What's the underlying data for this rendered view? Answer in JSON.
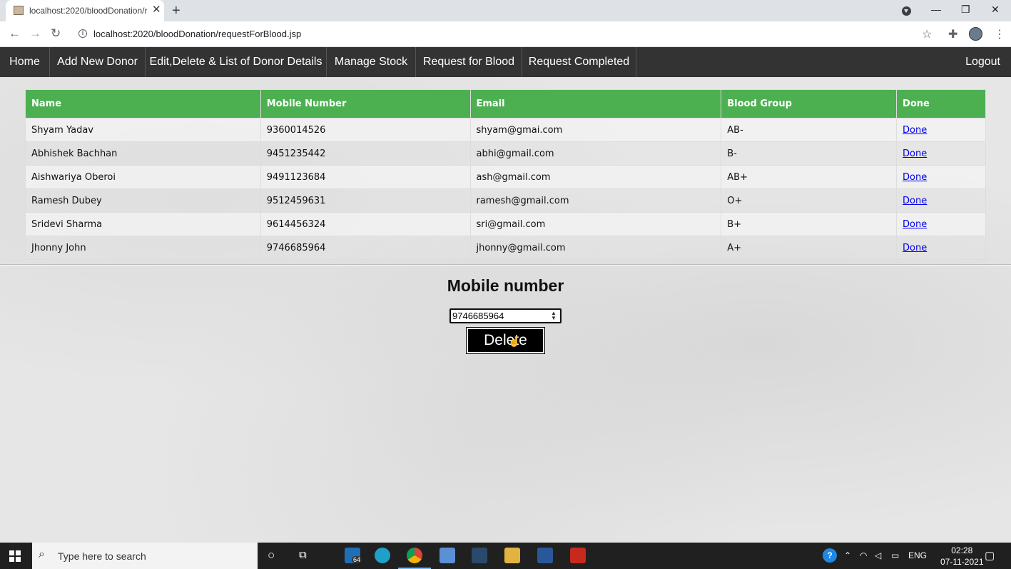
{
  "browser": {
    "tab_title": "localhost:2020/bloodDonation/requestForBlood.jsp",
    "new_tab": "+",
    "url": "localhost:2020/bloodDonation/requestForBlood.jsp",
    "icons": [
      "back-icon",
      "forward-icon",
      "reload-icon",
      "info-icon",
      "star-icon",
      "extensions-icon",
      "profile-avatar",
      "menu-icon"
    ]
  },
  "navbar": {
    "items": [
      {
        "label": "Home"
      },
      {
        "label": "Add New Donor"
      },
      {
        "label": "Edit,Delete & List of Donor Details"
      },
      {
        "label": "Manage Stock"
      },
      {
        "label": "Request for Blood"
      },
      {
        "label": "Request Completed"
      }
    ],
    "logout": "Logout"
  },
  "table": {
    "headers": [
      "Name",
      "Mobile Number",
      "Email",
      "Blood Group",
      "Done"
    ],
    "rows": [
      {
        "name": "Shyam Yadav",
        "mobile": "9360014526",
        "email": "shyam@gmai.com",
        "blood_group": "AB-",
        "action": "Done"
      },
      {
        "name": "Abhishek Bachhan",
        "mobile": "9451235442",
        "email": "abhi@gmail.com",
        "blood_group": "B-",
        "action": "Done"
      },
      {
        "name": "Aishwariya Oberoi",
        "mobile": "9491123684",
        "email": "ash@gmail.com",
        "blood_group": "AB+",
        "action": "Done"
      },
      {
        "name": "Ramesh Dubey",
        "mobile": "9512459631",
        "email": "ramesh@gmail.com",
        "blood_group": "O+",
        "action": "Done"
      },
      {
        "name": "Sridevi Sharma",
        "mobile": "9614456324",
        "email": "sri@gmail.com",
        "blood_group": "B+",
        "action": "Done"
      },
      {
        "name": "Jhonny John",
        "mobile": "9746685964",
        "email": "jhonny@gmail.com",
        "blood_group": "A+",
        "action": "Done"
      }
    ]
  },
  "form": {
    "title": "Mobile number",
    "mobile_value": "9746685964",
    "delete_label": "Delete"
  },
  "taskbar": {
    "search_placeholder": "Type here to search",
    "badge": "64",
    "language": "ENG",
    "time": "02:28",
    "date": "07-11-2021"
  },
  "colors": {
    "navbar_bg": "#333333",
    "table_header_bg": "#4caf50",
    "link": "#0000ee",
    "button_bg": "#000000"
  }
}
